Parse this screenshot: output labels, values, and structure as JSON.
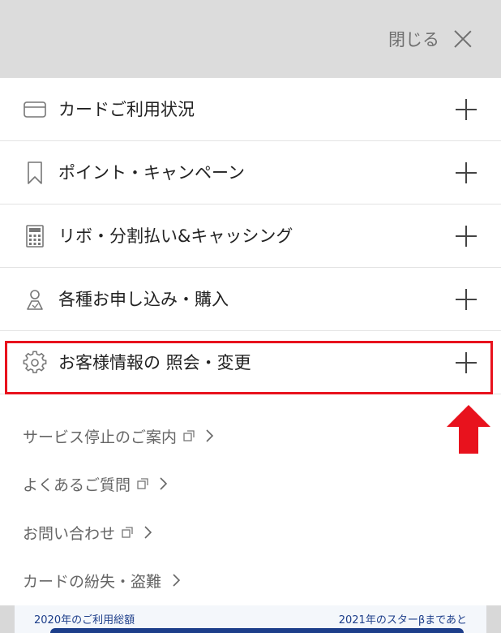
{
  "header": {
    "close_label": "閉じる"
  },
  "menu": [
    {
      "label": "カードご利用状況",
      "icon": "credit-card-icon"
    },
    {
      "label": "ポイント・キャンペーン",
      "icon": "bookmark-icon"
    },
    {
      "label": "リボ・分割払い&キャッシング",
      "icon": "calculator-icon"
    },
    {
      "label": "各種お申し込み・購入",
      "icon": "person-icon"
    },
    {
      "label": "お客様情報の 照会・変更",
      "icon": "gear-icon"
    }
  ],
  "links": [
    {
      "label": "サービス停止のご案内",
      "external": true
    },
    {
      "label": "よくあるご質問",
      "external": true
    },
    {
      "label": "お問い合わせ",
      "external": true
    },
    {
      "label": "カードの紛失・盗難",
      "external": false
    }
  ],
  "bottom": {
    "left_label": "2020年のご利用総額",
    "right_label": "2021年のスターβまであと"
  },
  "colors": {
    "highlight": "#e8121d",
    "header_bg": "#dcdcdc",
    "accent_blue": "#1d3e8a"
  }
}
